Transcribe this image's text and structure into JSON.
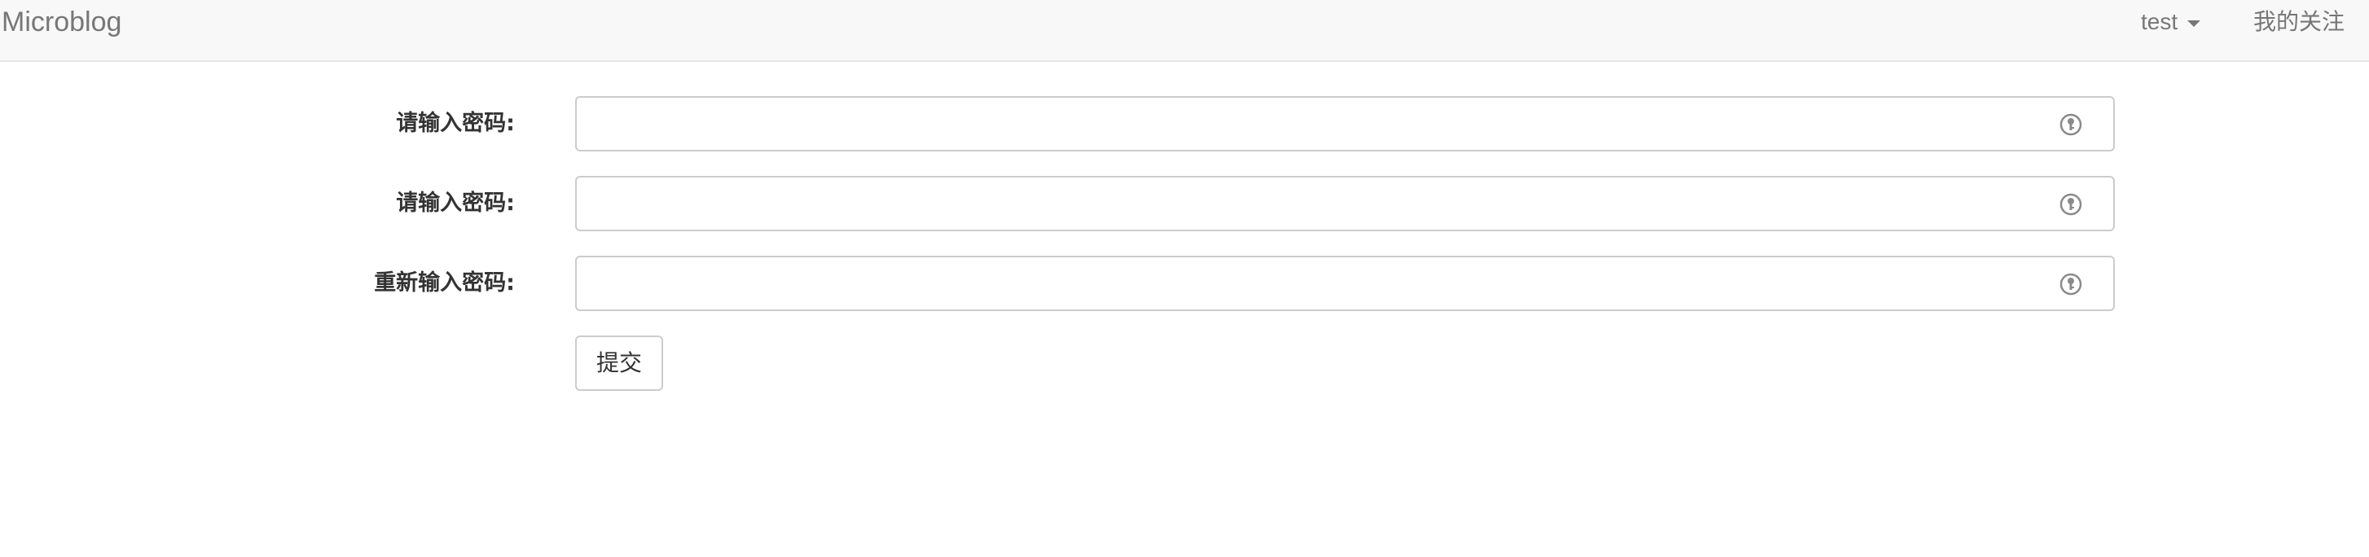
{
  "navbar": {
    "brand": "Microblog",
    "user_menu_label": "test",
    "follow_label": "我的关注"
  },
  "form": {
    "fields": [
      {
        "label": "请输入密码:",
        "value": "",
        "icon": "key-icon"
      },
      {
        "label": "请输入密码:",
        "value": "",
        "icon": "key-icon"
      },
      {
        "label": "重新输入密码:",
        "value": "",
        "icon": "key-icon"
      }
    ],
    "submit_label": "提交"
  },
  "colors": {
    "navbar_bg": "#f8f8f8",
    "navbar_text": "#777777",
    "input_border": "#cccccc",
    "label_text": "#333333"
  }
}
